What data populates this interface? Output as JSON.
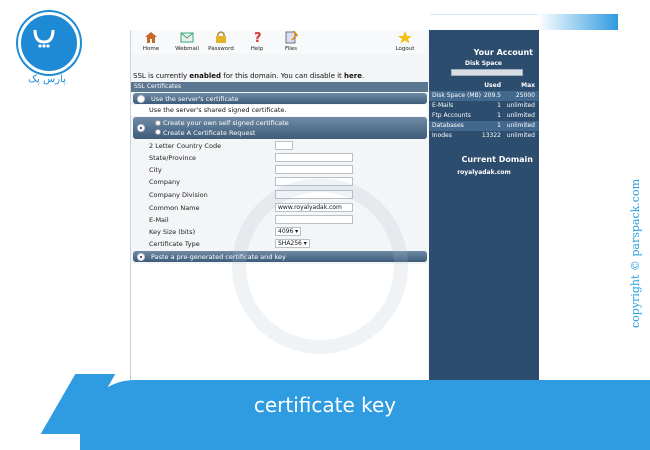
{
  "brand": {
    "logo_text": "پارس پک",
    "copyright": "copyright © parspack.com",
    "caption": "certificate key",
    "accent_color": "#2f9be0"
  },
  "toolbar": {
    "items": [
      {
        "label": "Home",
        "icon": "home-icon"
      },
      {
        "label": "Webmail",
        "icon": "webmail-icon"
      },
      {
        "label": "Password",
        "icon": "lock-icon"
      },
      {
        "label": "Help",
        "icon": "help-icon"
      },
      {
        "label": "Files",
        "icon": "files-icon"
      },
      {
        "label": "Logout",
        "icon": "logout-star-icon"
      }
    ]
  },
  "ssl": {
    "status_prefix": "SSL is currently ",
    "status_state": "enabled",
    "status_middle": " for this domain. You can disable it ",
    "status_link": "here",
    "status_end": ".",
    "section_title": "SSL Certificates",
    "option_server_cert": "Use the server's certificate",
    "option_server_info": "Use the server's shared signed certificate.",
    "option_self_signed": "Create your own self signed certificate",
    "option_request": "Create A Certificate Request",
    "option_paste": "Paste a pre-generated certificate and key"
  },
  "form": {
    "fields": [
      {
        "label": "2 Letter Country Code",
        "value": ""
      },
      {
        "label": "State/Province",
        "value": ""
      },
      {
        "label": "City",
        "value": ""
      },
      {
        "label": "Company",
        "value": ""
      },
      {
        "label": "Company Division",
        "value": ""
      },
      {
        "label": "Common Name",
        "value": "www.royalyadak.com"
      },
      {
        "label": "E-Mail",
        "value": ""
      }
    ],
    "key_size_label": "Key Size (bits)",
    "key_size_value": "4096 ▾",
    "cert_type_label": "Certificate Type",
    "cert_type_value": "SHA256 ▾"
  },
  "account": {
    "top_text": "...",
    "title": "Your Account",
    "disk_space_label": "Disk Space",
    "col_used": "Used",
    "col_max": "Max",
    "rows": [
      {
        "name": "Disk Space (MB)",
        "used": "209.5",
        "max": "25000"
      },
      {
        "name": "E-Mails",
        "used": "1",
        "max": "unlimited"
      },
      {
        "name": "Ftp Accounts",
        "used": "1",
        "max": "unlimited"
      },
      {
        "name": "Databases",
        "used": "1",
        "max": "unlimited"
      },
      {
        "name": "Inodes",
        "used": "13322",
        "max": "unlimited"
      }
    ],
    "current_domain_title": "Current Domain",
    "current_domain": "royalyadak.com"
  }
}
